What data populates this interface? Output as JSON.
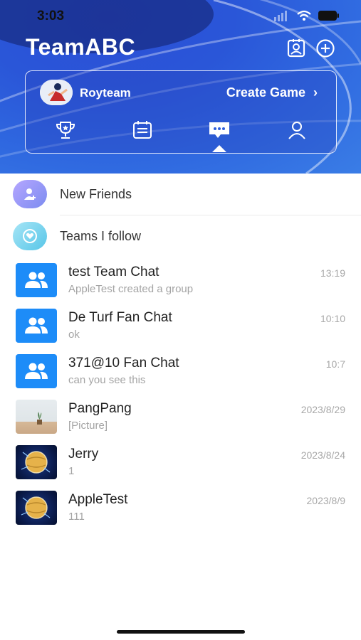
{
  "status_bar": {
    "time": "3:03"
  },
  "header": {
    "title": "TeamABC",
    "team_name": "Royteam",
    "create_game": "Create Game",
    "icons": [
      "contact-card-icon",
      "add-circle-icon",
      "trophy-icon",
      "calendar-list-icon",
      "chat-bubble-icon",
      "person-icon"
    ]
  },
  "specials": [
    {
      "label": "New Friends",
      "icon": "add-person-icon",
      "color": "#9a8cf5"
    },
    {
      "label": "Teams I follow",
      "icon": "heart-icon",
      "color": "#7fd6ee"
    }
  ],
  "chats": [
    {
      "name": "test Team Chat",
      "message": "AppleTest created a group",
      "time": "13:19",
      "avatar": "group-icon"
    },
    {
      "name": "De Turf Fan Chat",
      "message": "ok",
      "time": "10:10",
      "avatar": "group-icon"
    },
    {
      "name": "371@10 Fan Chat",
      "message": "can you see this",
      "time": "10:7",
      "avatar": "group-icon"
    },
    {
      "name": "PangPang",
      "message": "[Picture]",
      "time": "2023/8/29",
      "avatar": "plant-photo"
    },
    {
      "name": "Jerry",
      "message": "1",
      "time": "2023/8/24",
      "avatar": "globe-photo"
    },
    {
      "name": "AppleTest",
      "message": "111",
      "time": "2023/8/9",
      "avatar": "globe-photo"
    }
  ],
  "colors": {
    "accent_blue": "#1d8cf8",
    "header_blue": "#2f5fdc"
  }
}
